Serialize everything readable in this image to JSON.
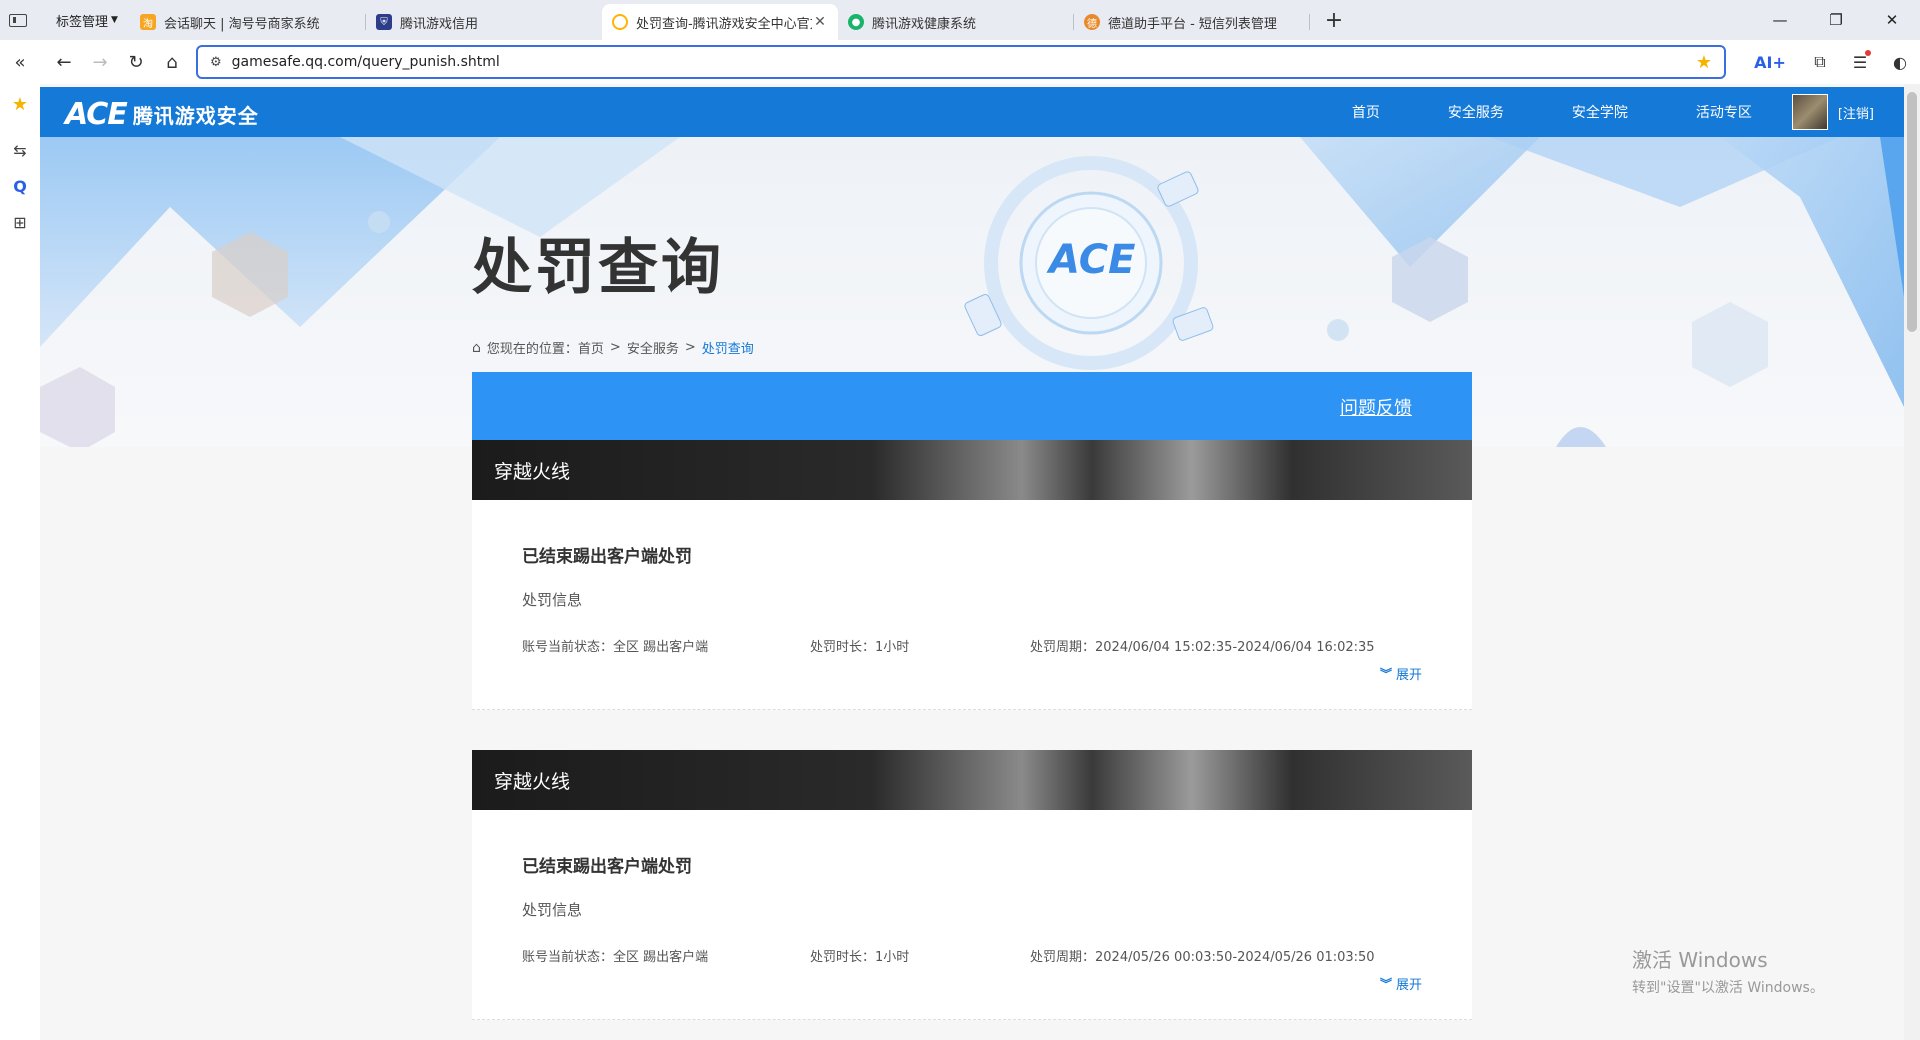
{
  "browser": {
    "tab_manager_label": "标签管理",
    "tabs": [
      {
        "title": "会话聊天 | 淘号号商家系统",
        "color": "#f6a623"
      },
      {
        "title": "腾讯游戏信用",
        "color": "#2c3e8a"
      },
      {
        "title": "处罚查询-腾讯游戏安全中心官方网站",
        "color": "#ffb400"
      },
      {
        "title": "腾讯游戏健康系统",
        "color": "#19b36b"
      },
      {
        "title": "德道助手平台 - 短信列表管理",
        "color": "#e88a2a"
      }
    ],
    "url": "gamesafe.qq.com/query_punish.shtml",
    "ai_label": "AI+"
  },
  "site": {
    "logo_ace": "ACE",
    "logo_name": "腾讯游戏安全",
    "nav": [
      "首页",
      "安全服务",
      "安全学院",
      "活动专区"
    ],
    "logout": "[注销]"
  },
  "page": {
    "title": "处罚查询",
    "breadcrumb": {
      "prefix": "您现在的位置：",
      "items": [
        "首页",
        "安全服务",
        "处罚查询"
      ]
    },
    "feedback": "问题反馈",
    "records": [
      {
        "game": "穿越火线",
        "status": "已结束踢出客户端处罚",
        "info_label": "处罚信息",
        "account_state": "账号当前状态：全区 踢出客户端",
        "duration": "处罚时长：1小时",
        "period": "处罚周期：2024/06/04 15:02:35-2024/06/04 16:02:35",
        "expand": "展开"
      },
      {
        "game": "穿越火线",
        "status": "已结束踢出客户端处罚",
        "info_label": "处罚信息",
        "account_state": "账号当前状态：全区 踢出客户端",
        "duration": "处罚时长：1小时",
        "period": "处罚周期：2024/05/26 00:03:50-2024/05/26 01:03:50",
        "expand": "展开"
      }
    ]
  },
  "watermark": {
    "line1": "激活 Windows",
    "line2": "转到\"设置\"以激活 Windows。"
  },
  "colors": {
    "brand_blue": "#1479d7",
    "feedback_blue": "#2d94f5"
  }
}
